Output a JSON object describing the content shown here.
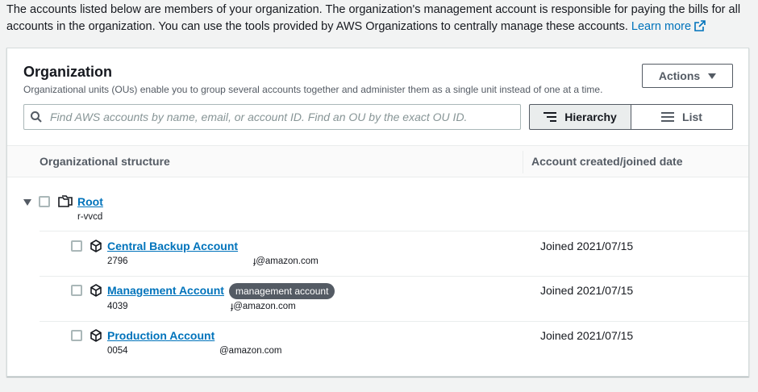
{
  "intro": {
    "text": "The accounts listed below are members of your organization. The organization's management account is responsible for paying the bills for all accounts in the organization. You can use the tools provided by AWS Organizations to centrally manage these accounts.",
    "learn_more": "Learn more"
  },
  "panel": {
    "title": "Organization",
    "description": "Organizational units (OUs) enable you to group several accounts together and administer them as a single unit instead of one at a time.",
    "actions_label": "Actions",
    "search_placeholder": "Find AWS accounts by name, email, or account ID. Find an OU by the exact OU ID.",
    "view_hierarchy": "Hierarchy",
    "view_list": "List"
  },
  "table": {
    "col_structure": "Organizational structure",
    "col_date": "Account created/joined date",
    "root": {
      "name": "Root",
      "id": "r-vvcd"
    },
    "accounts": [
      {
        "name": "Central Backup Account",
        "id": "2796",
        "email": "ɟ@amazon.com",
        "joined": "Joined 2021/07/15",
        "badge": ""
      },
      {
        "name": "Management Account",
        "id": "4039",
        "email": "ɟ@amazon.com",
        "joined": "Joined 2021/07/15",
        "badge": "management account"
      },
      {
        "name": "Production Account",
        "id": "0054",
        "email": "@amazon.com",
        "joined": "Joined 2021/07/15",
        "badge": ""
      }
    ]
  },
  "colors": {
    "link": "#0073bb",
    "text": "#16191f",
    "muted": "#545b64",
    "badge": "#545b64"
  }
}
